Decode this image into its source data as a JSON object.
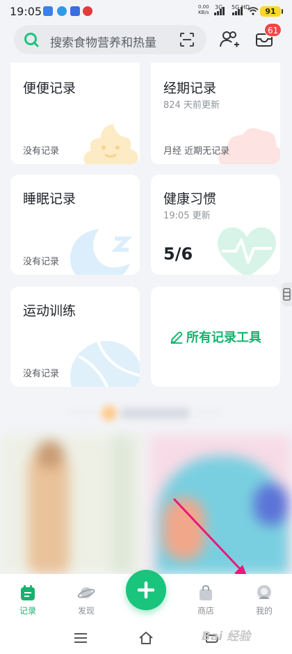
{
  "status_bar": {
    "time": "19:05",
    "net_speed": "0.00",
    "net_unit": "KB/s",
    "network_3g": "3G",
    "network_5g": "5G HD",
    "battery": "91"
  },
  "header": {
    "search_placeholder": "搜索食物营养和热量",
    "message_badge": "61"
  },
  "cards": {
    "bowel": {
      "title": "便便记录",
      "status": "没有记录"
    },
    "period": {
      "title": "经期记录",
      "subtitle": "824 天前更新",
      "status": "月经 近期无记录"
    },
    "sleep": {
      "title": "睡眠记录",
      "status": "没有记录"
    },
    "habit": {
      "title": "健康习惯",
      "subtitle": "19:05 更新",
      "progress": "5/6"
    },
    "exercise": {
      "title": "运动训练",
      "status": "没有记录"
    },
    "all_tools": {
      "label": "所有记录工具"
    }
  },
  "tabs": [
    {
      "label": "记录",
      "icon": "calendar-icon",
      "active": true
    },
    {
      "label": "发现",
      "icon": "planet-icon",
      "active": false
    },
    {
      "label": "商店",
      "icon": "shop-bag-icon",
      "active": false
    },
    {
      "label": "我的",
      "icon": "profile-icon",
      "active": false
    }
  ],
  "colors": {
    "brand_green": "#16b26f",
    "fab_green": "#19c47c",
    "badge_red": "#f04848",
    "annotation_arrow": "#e8197a"
  },
  "watermark": "Bai 经验"
}
